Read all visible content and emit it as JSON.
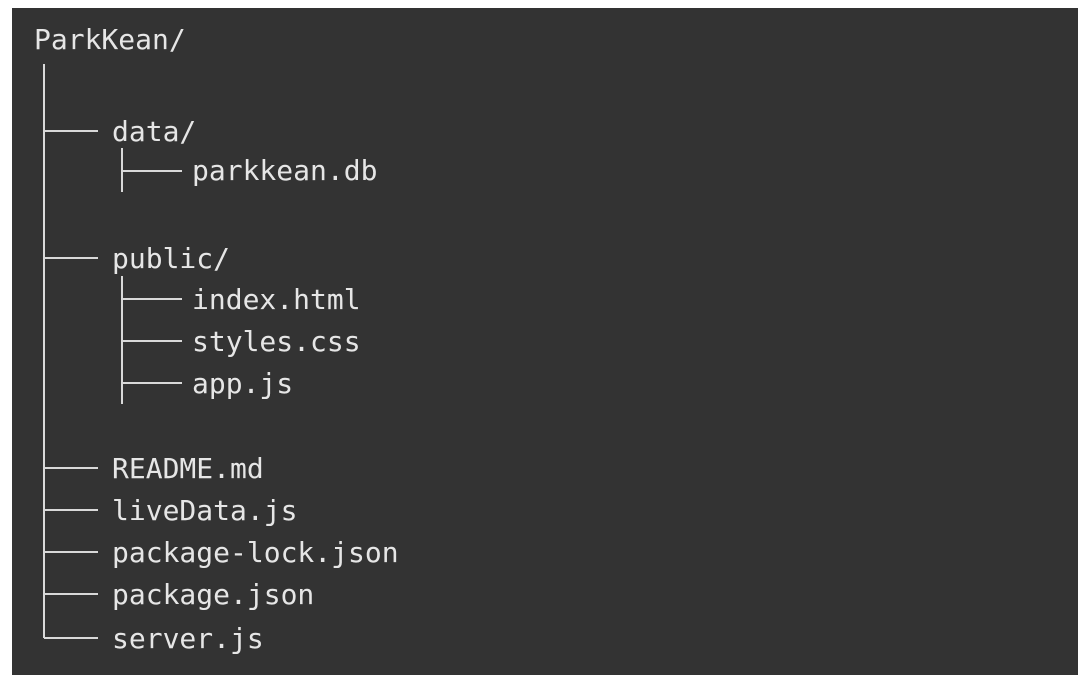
{
  "tree": {
    "root": "ParkKean/",
    "children": [
      {
        "name": "data/",
        "children": [
          {
            "name": "parkkean.db"
          }
        ]
      },
      {
        "name": "public/",
        "children": [
          {
            "name": "index.html"
          },
          {
            "name": "styles.css"
          },
          {
            "name": "app.js"
          }
        ]
      },
      {
        "name": "README.md"
      },
      {
        "name": "liveData.js"
      },
      {
        "name": "package-lock.json"
      },
      {
        "name": "package.json"
      },
      {
        "name": "server.js"
      }
    ]
  },
  "colors": {
    "background": "#333333",
    "text": "#e6e6e6",
    "lines": "#d9d9d9"
  }
}
